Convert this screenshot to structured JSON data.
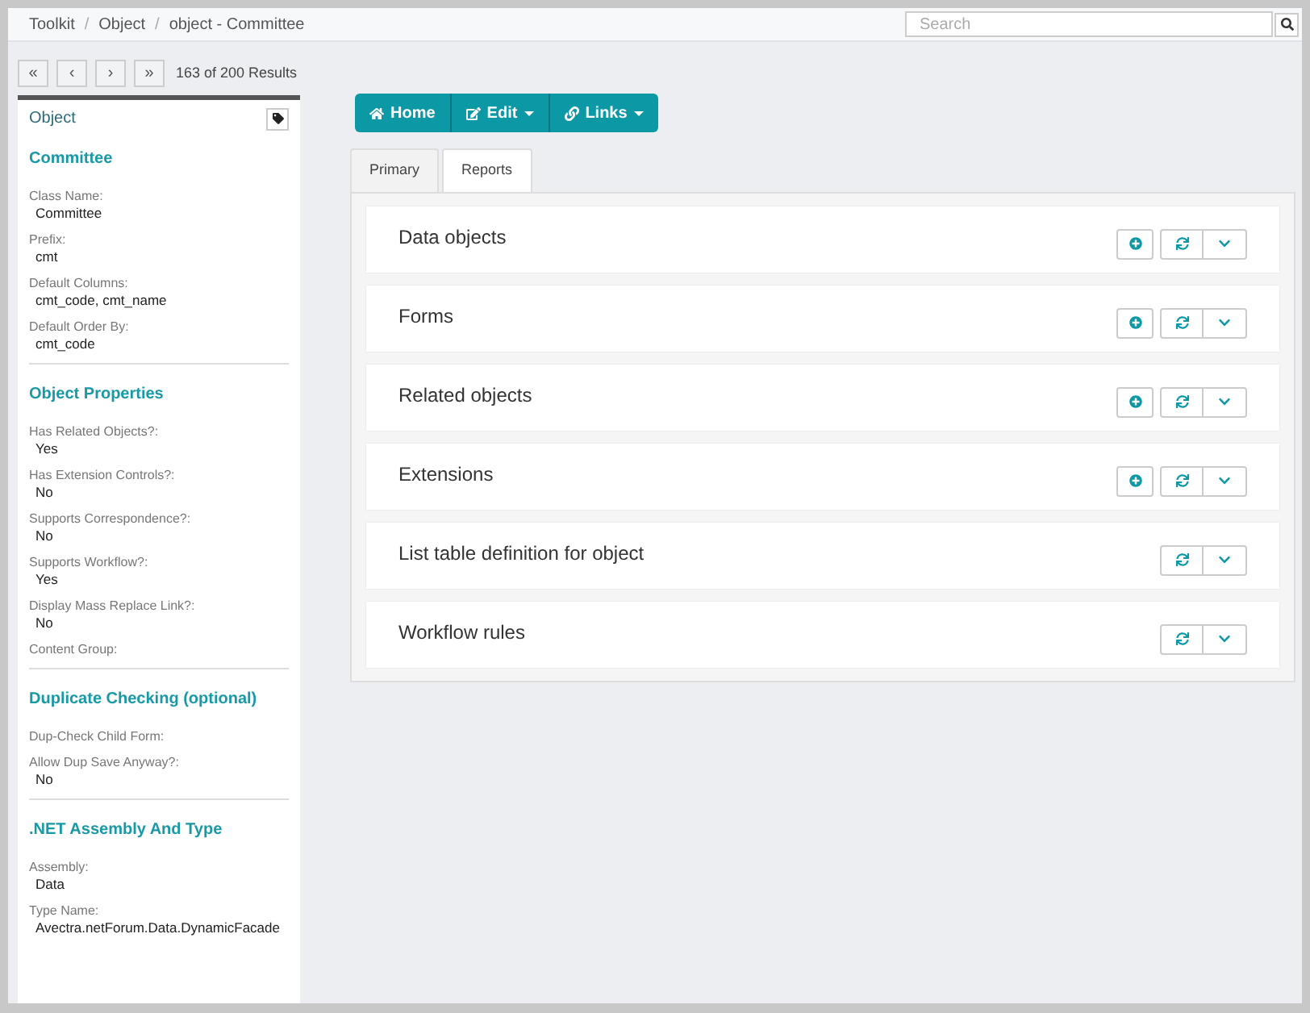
{
  "breadcrumb": [
    "Toolkit",
    "Object",
    "object - Committee"
  ],
  "breadcrumb_separator": "/",
  "search": {
    "placeholder": "Search"
  },
  "pager": {
    "buttons": [
      "«",
      "‹",
      "›",
      "»"
    ],
    "results": "163 of 200 Results"
  },
  "sidebar": {
    "title": "Object",
    "sections": [
      {
        "heading": "Committee",
        "fields": [
          {
            "label": "Class Name:",
            "value": "Committee"
          },
          {
            "label": "Prefix:",
            "value": "cmt"
          },
          {
            "label": "Default Columns:",
            "value": "cmt_code, cmt_name"
          },
          {
            "label": "Default Order By:",
            "value": "cmt_code"
          }
        ]
      },
      {
        "heading": "Object Properties",
        "fields": [
          {
            "label": "Has Related Objects?:",
            "value": "Yes"
          },
          {
            "label": "Has Extension Controls?:",
            "value": "No"
          },
          {
            "label": "Supports Correspondence?:",
            "value": "No"
          },
          {
            "label": "Supports Workflow?:",
            "value": "Yes"
          },
          {
            "label": "Display Mass Replace Link?:",
            "value": "No"
          },
          {
            "label": "Content Group:"
          }
        ]
      },
      {
        "heading": "Duplicate Checking (optional)",
        "fields": [
          {
            "label": "Dup-Check Child Form:"
          },
          {
            "label": "Allow Dup Save Anyway?:",
            "value": "No"
          }
        ]
      },
      {
        "heading": ".NET Assembly And Type",
        "fields": [
          {
            "label": "Assembly:",
            "value": "Data"
          },
          {
            "label": "Type Name:",
            "value": "Avectra.netForum.Data.DynamicFacade"
          }
        ]
      }
    ]
  },
  "toolbar": [
    {
      "kind": "home",
      "label": "Home"
    },
    {
      "kind": "edit",
      "label": "Edit"
    },
    {
      "kind": "links",
      "label": "Links"
    }
  ],
  "tabs": [
    {
      "label": "Primary",
      "selected": false
    },
    {
      "label": "Reports",
      "selected": true
    }
  ],
  "panels": [
    {
      "title": "Data objects",
      "has_add": true
    },
    {
      "title": "Forms",
      "has_add": true
    },
    {
      "title": "Related objects",
      "has_add": true
    },
    {
      "title": "Extensions",
      "has_add": true
    },
    {
      "title": "List table definition for object",
      "has_add": false
    },
    {
      "title": "Workflow rules",
      "has_add": false
    }
  ]
}
